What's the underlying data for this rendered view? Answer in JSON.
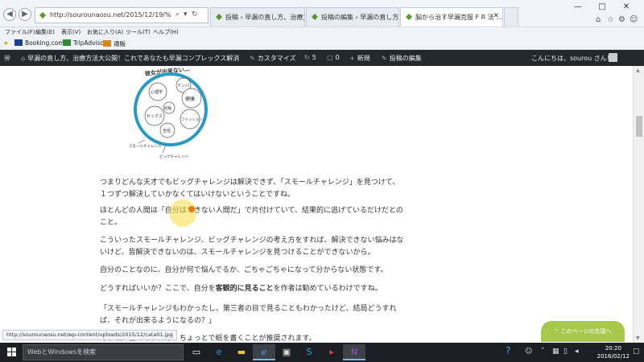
{
  "browser": {
    "address_url": "http://sourounaosu.net/2015/12/19/%e0%84%b3%e3!",
    "search_icon": "search-icon",
    "refresh_icon": "refresh-icon",
    "tabs": [
      {
        "label": "投稿 ‹ 早漏の直し方、治療方法..."
      },
      {
        "label": "投稿の編集 ‹ 早漏の直し方、治..."
      },
      {
        "label": "脳から治す早漏克服 F R 法 ..."
      }
    ],
    "window_controls": [
      "—",
      "□",
      "✕"
    ],
    "right_icons": [
      "⌂",
      "☆",
      "⚙",
      "☺"
    ]
  },
  "menu": {
    "items": [
      "ファイル(F)",
      "編集(E)",
      "表示(V)",
      "お気に入り(A)",
      "ツール(T)",
      "ヘルプ(H)"
    ]
  },
  "favorites": {
    "items": [
      {
        "label": "Booking.com",
        "color": "#1a3d8f"
      },
      {
        "label": "TripAdvisor",
        "color": "#2e8b2e"
      },
      {
        "label": "通販",
        "color": "#d9851a"
      }
    ]
  },
  "wp_admin": {
    "site_title": "早漏の直し方、治療方法大公開！これであなたも早漏コンプレックス解消",
    "customize": "カスタマイズ",
    "updates_count": "5",
    "comments_count": "0",
    "new_label": "新規",
    "edit_post": "投稿の編集",
    "greeting": "こんにちは、sourou さん！"
  },
  "diagram": {
    "arc_text": "彼女が出来ない…",
    "bubbles": [
      "テンパ",
      "心理学",
      "健康",
      "経験",
      "セックス",
      "ファッション",
      "自信"
    ],
    "small_label": "スモールチャレンジ",
    "big_label": "ビッグチャレンジ"
  },
  "article": {
    "p1": "つまりどんな天才でもビッグチャレンジは解決できず、「スモールチャレンジ」を見つけて、１つずつ解決していかなくてはいけないということですね。",
    "p2": "ほとんどの人間は「自分はできない人間だ」で片付けていて、結果的に逃げているだけだとのこと。",
    "p3": "こういったスモールチャレンジ、ビッグチャレンジの考え方をすれば、解決できない悩みはないけど、皆解決できないのは、スモールチャレンジを見つけることができないから。",
    "p4": "自分のことなのに、自分が何で悩んでるか、ごちゃごちゃになって分からない状態です。",
    "p5_pre": "どうすればいいか？ここで、自分を",
    "p5_bold": "客観的に見ること",
    "p5_post": "を作者は勧めているわけですね。",
    "p6": "「スモールチャレンジもわかったし、第三者の目で見ることもわかったけど、結局どうすれば、それが出来るようになるの？」",
    "p7": "そう紙に書くとすれば、ちょっとで紙を書くことが推奨されます。"
  },
  "status_url": "http://sourounaosu.net/wp-content/uploads/2015/12/cata01.jpg",
  "page_top": "このページの先頭へ",
  "taskbar": {
    "search_placeholder": "WebとWindowsを検索",
    "time": "20:20",
    "date": "2016/02/12"
  },
  "colors": {
    "wp_bar": "#23282d",
    "page_top": "#a6c84b",
    "diagram_ring": "#2a9ac4"
  }
}
